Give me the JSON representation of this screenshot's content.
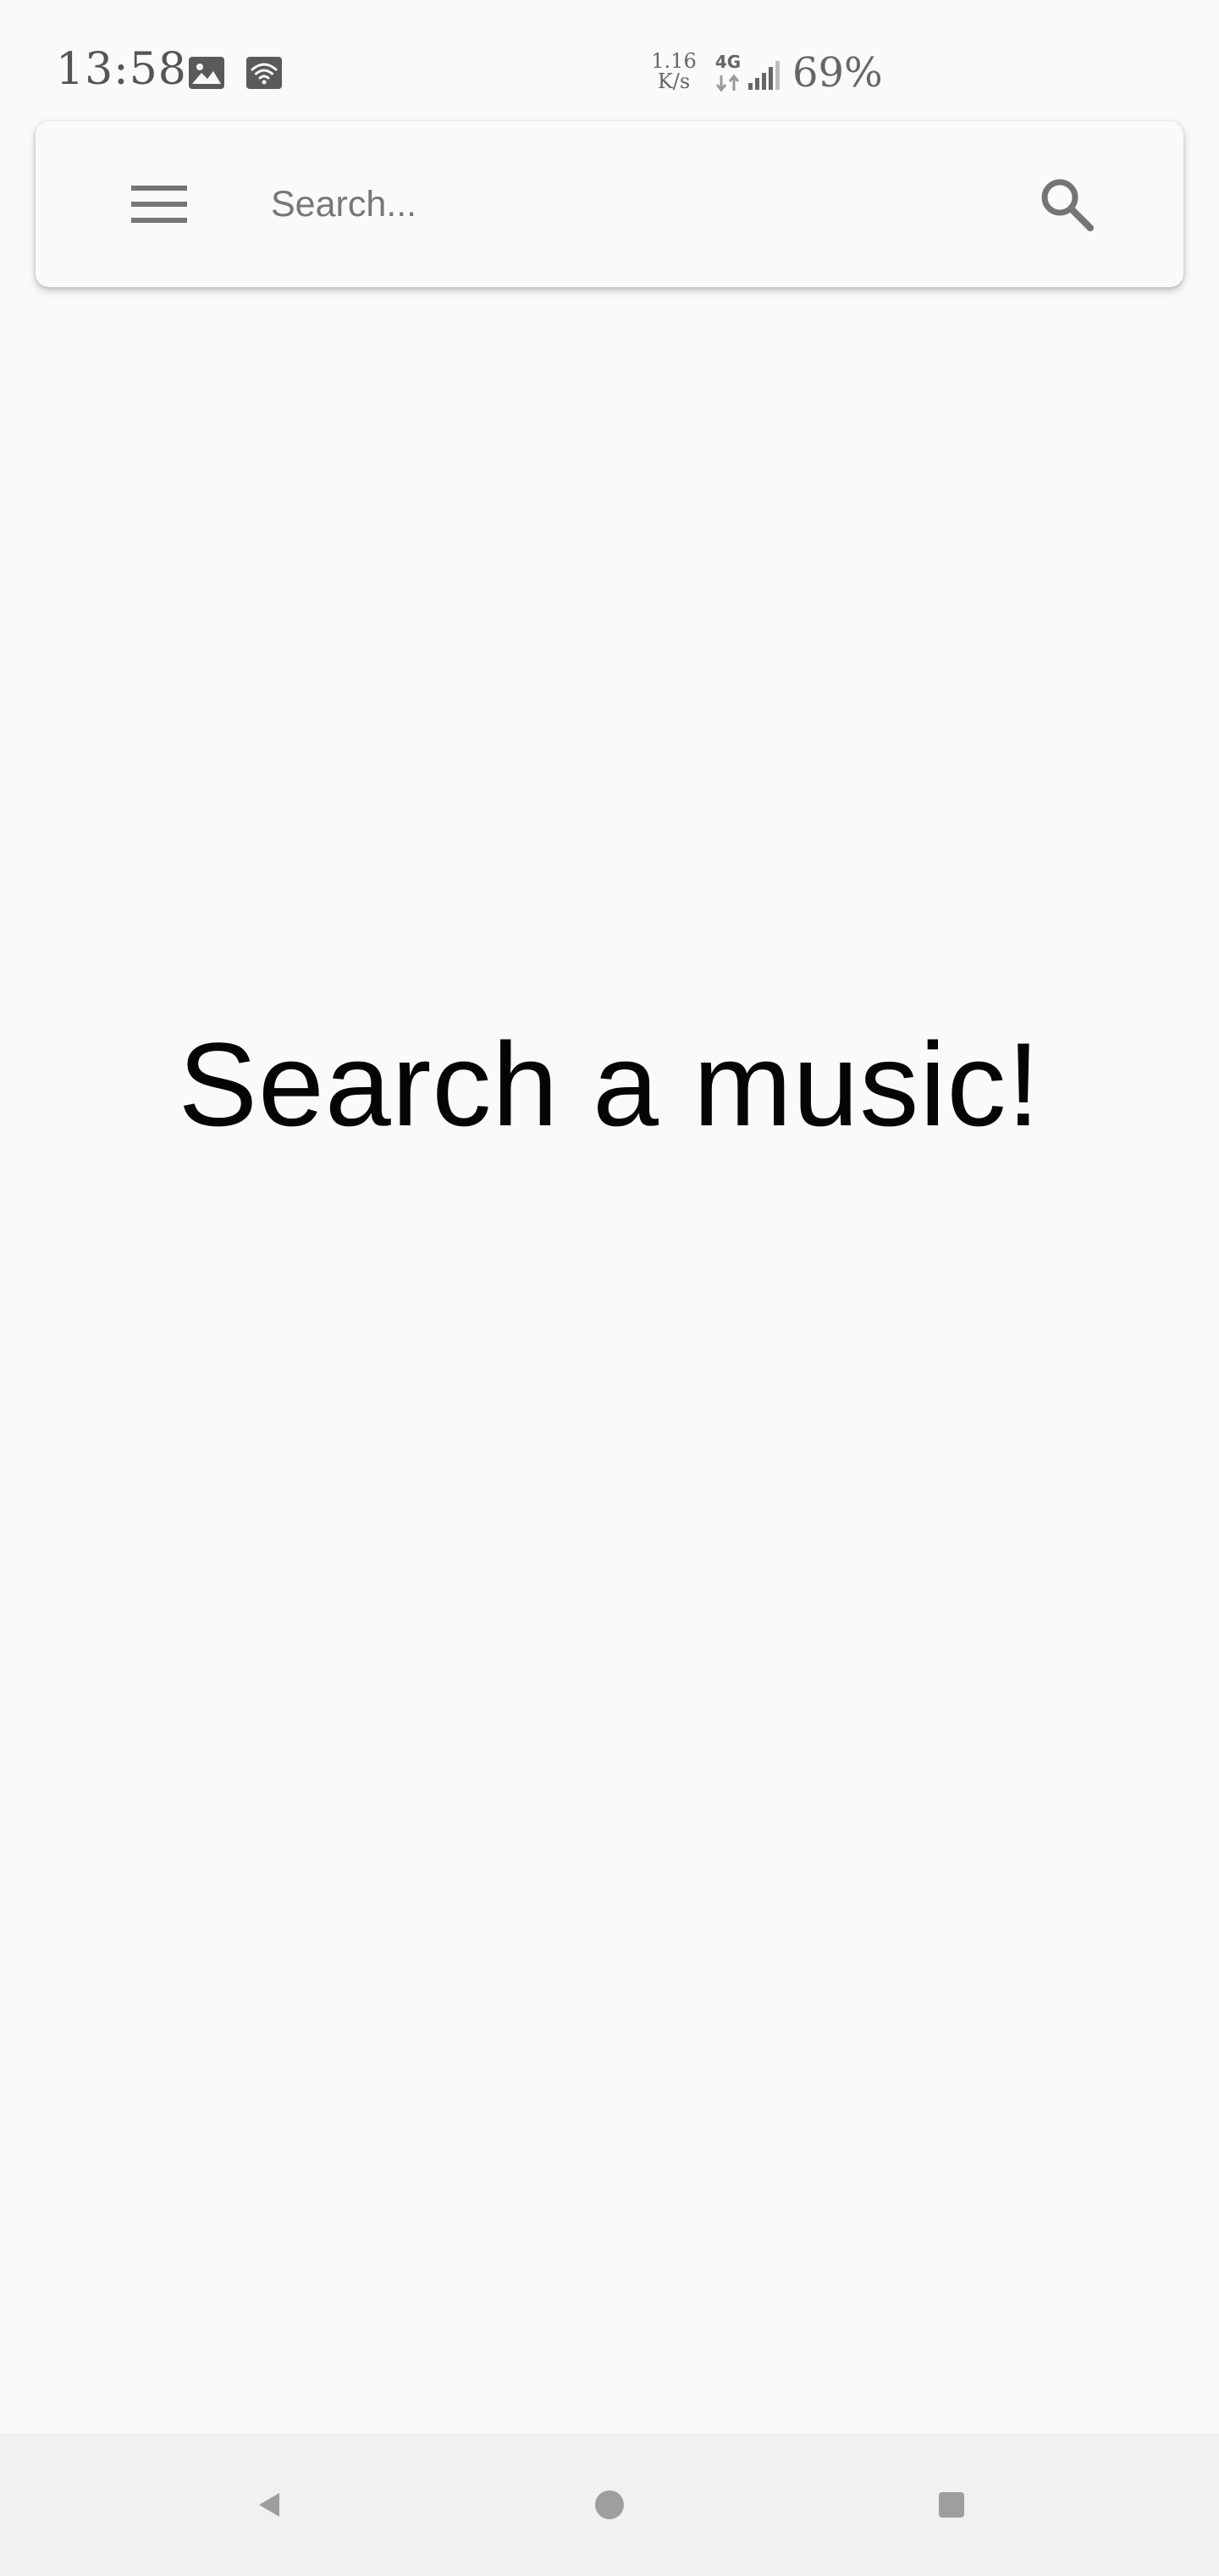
{
  "status_bar": {
    "time": "13:58",
    "notification_icons": [
      "gallery-icon",
      "wifi-icon"
    ],
    "net_speed_value": "1.16",
    "net_speed_unit": "K/s",
    "network_type": "4G",
    "battery": "69%"
  },
  "search_bar": {
    "menu_icon": "hamburger-menu-icon",
    "placeholder": "Search...",
    "value": "",
    "search_icon": "magnifier-icon"
  },
  "main": {
    "empty_message": "Search a music!"
  },
  "nav_bar": {
    "buttons": [
      "back-icon",
      "home-icon",
      "recents-icon"
    ]
  },
  "colors": {
    "background": "#fafafa",
    "nav_background": "#f1f1f1",
    "icon_gray": "#757575",
    "text_primary": "#050505"
  }
}
